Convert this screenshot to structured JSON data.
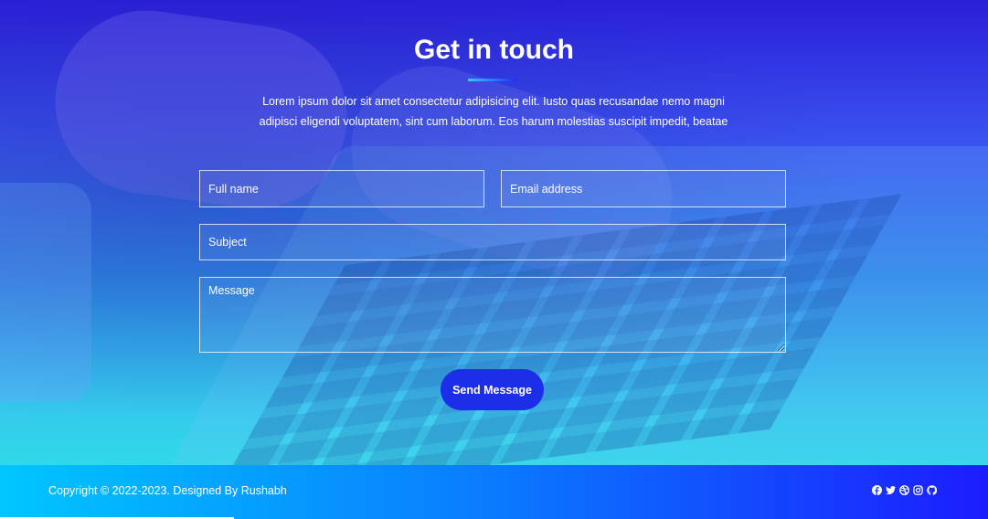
{
  "contact": {
    "title": "Get in touch",
    "description": "Lorem ipsum dolor sit amet consectetur adipisicing elit. Iusto quas recusandae nemo magni adipisci eligendi voluptatem, sint cum laborum. Eos harum molestias suscipit impedit, beatae",
    "form": {
      "full_name_placeholder": "Full name",
      "email_placeholder": "Email address",
      "subject_placeholder": "Subject",
      "message_placeholder": "Message",
      "send_label": "Send Message"
    }
  },
  "footer": {
    "copyright": "Copyright © 2022-2023. Designed By Rushabh",
    "socials": [
      "facebook-icon",
      "twitter-icon",
      "dribbble-icon",
      "instagram-icon",
      "github-icon"
    ]
  },
  "colors": {
    "button": "#1d2ee8",
    "footer_gradient_start": "#00c6ff",
    "footer_gradient_end": "#1c1cff",
    "hero_top": "#2a1fd8",
    "hero_bottom": "#2fd9e8"
  }
}
